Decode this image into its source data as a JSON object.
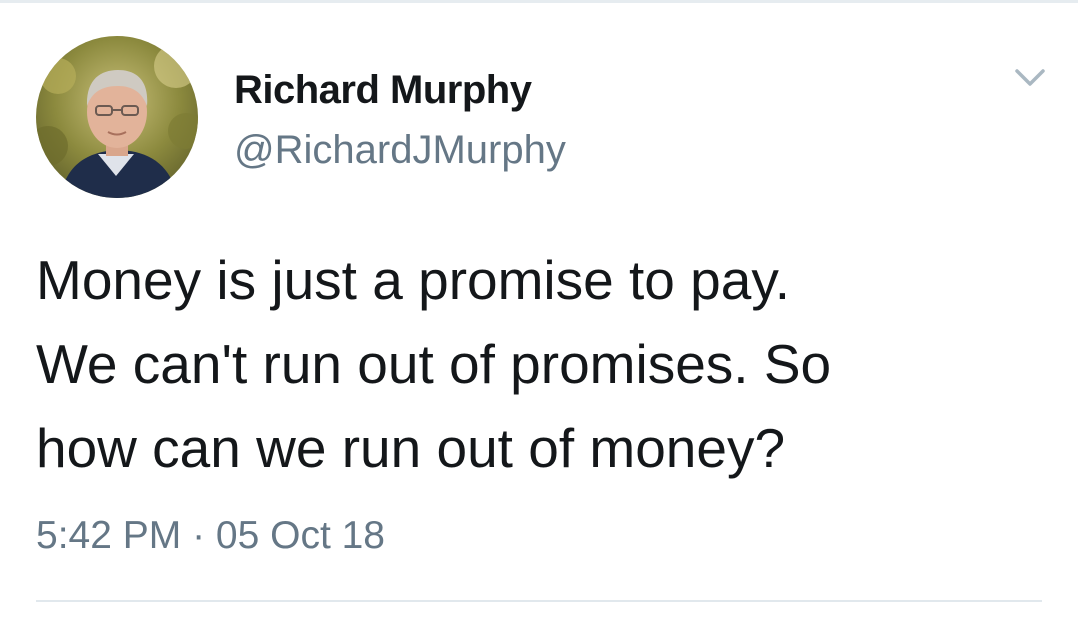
{
  "tweet": {
    "author": {
      "display_name": "Richard Murphy",
      "handle": "@RichardJMurphy",
      "avatar": "profile-photo"
    },
    "text_lines": [
      "Money is just a promise to pay.",
      "We can't run out of promises. So",
      "how can we run out of money?"
    ],
    "timestamp": "5:42 PM · 05 Oct 18",
    "menu_icon": "chevron-down-icon"
  },
  "colors": {
    "primary_text": "#14171a",
    "secondary_text": "#657786",
    "divider": "#e1e8ed",
    "caret": "#aab8c2"
  }
}
